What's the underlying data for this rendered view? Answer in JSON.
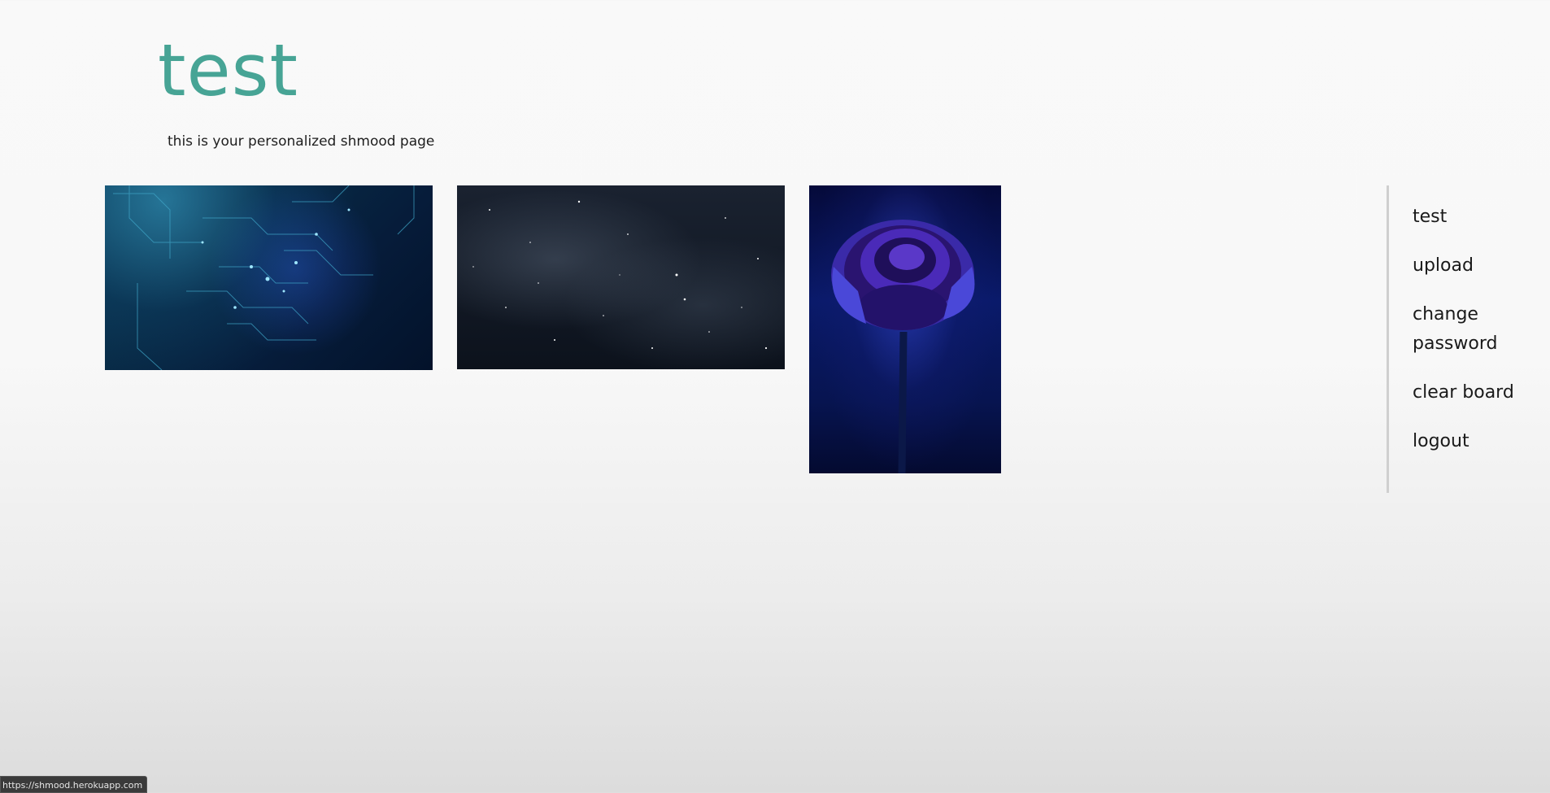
{
  "header": {
    "title": "test",
    "subtitle": "this is your personalized shmood page",
    "title_color": "#47a495"
  },
  "board": {
    "images": [
      {
        "description": "blue circuit board",
        "name": "circuit-image"
      },
      {
        "description": "starry night sky",
        "name": "space-image"
      },
      {
        "description": "purple rose",
        "name": "rose-image"
      }
    ]
  },
  "nav": {
    "items": [
      {
        "label": "test"
      },
      {
        "label": "upload"
      },
      {
        "label": "change password"
      },
      {
        "label": "clear board"
      },
      {
        "label": "logout"
      }
    ]
  },
  "status": {
    "url": "https://shmood.herokuapp.com"
  }
}
